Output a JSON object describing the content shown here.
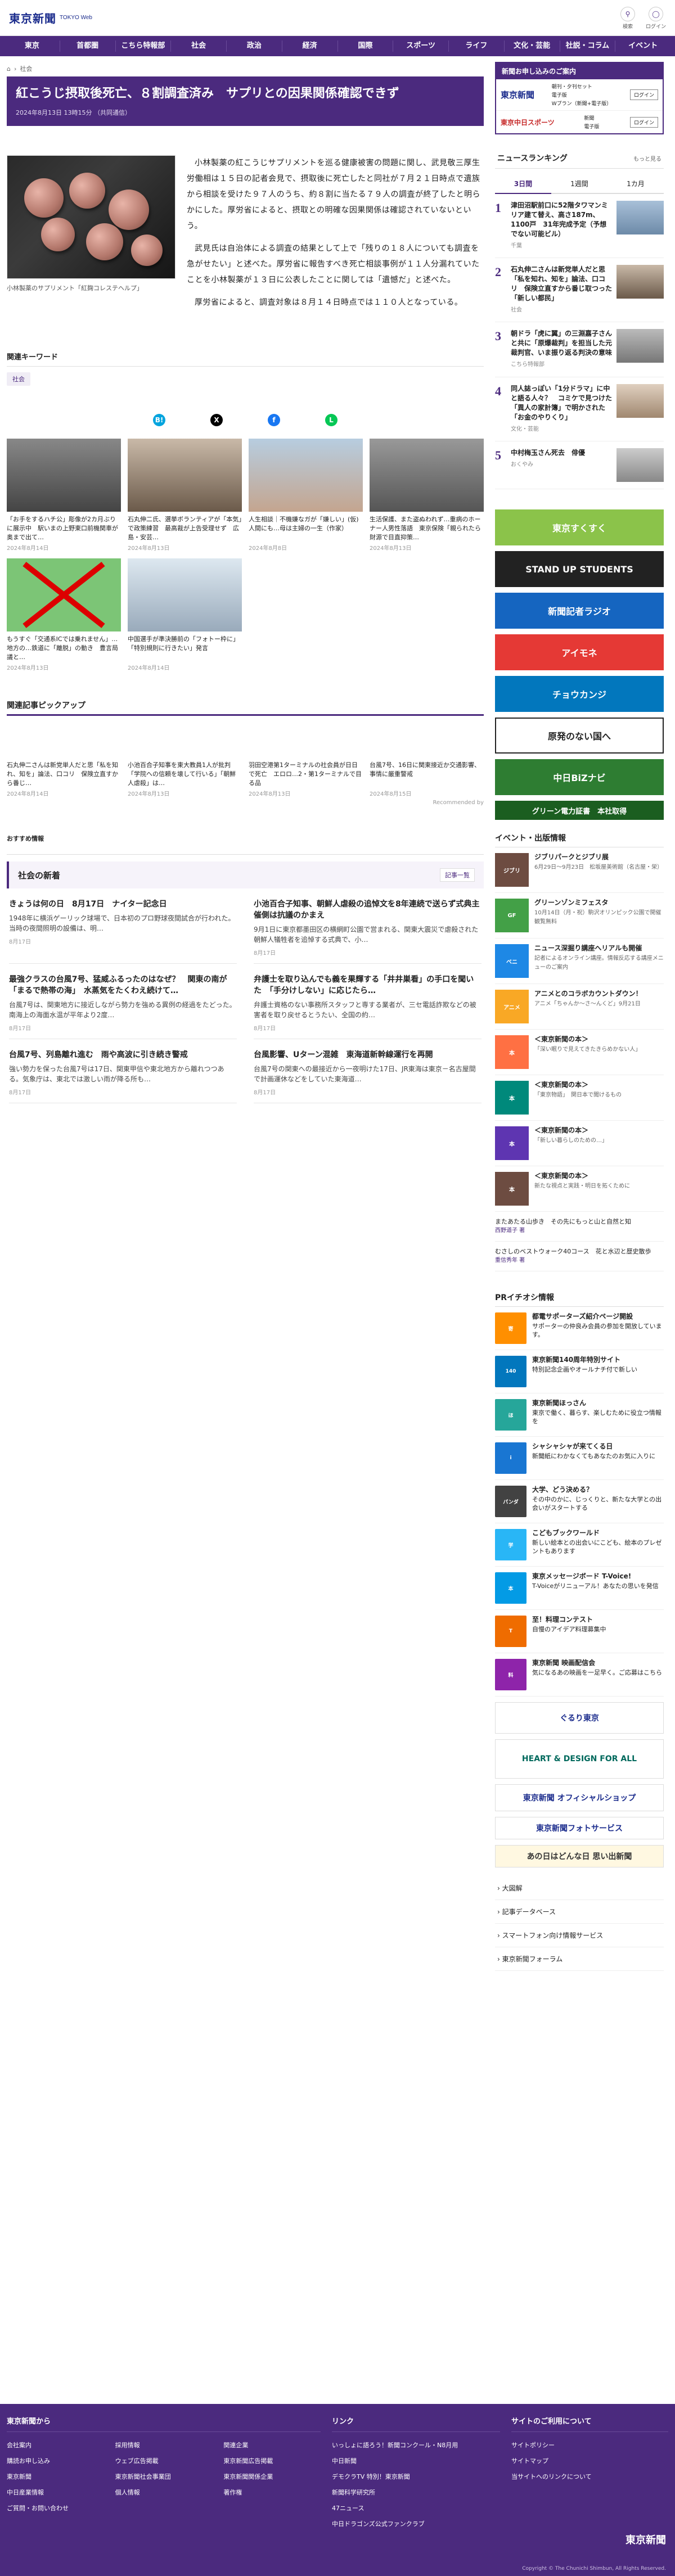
{
  "header": {
    "logo": "東京新聞",
    "logo_sub": "TOKYO Web",
    "search_label": "検索",
    "login_label": "ログイン"
  },
  "nav": [
    "東京",
    "首都圏",
    "こちら特報部",
    "社会",
    "政治",
    "経済",
    "国際",
    "スポーツ",
    "ライフ",
    "文化・芸能",
    "社説・コラム",
    "イベント"
  ],
  "breadcrumb": {
    "home": "ホーム",
    "current": "社会"
  },
  "article": {
    "title": "紅こうじ摂取後死亡、８割調査済み　サプリとの因果関係確認できず",
    "date": "2024年8月13日 13時15分",
    "source": "（共同通信）",
    "caption": "小林製薬のサプリメント「紅麹コレステヘルプ」",
    "paragraphs": [
      "小林製薬の紅こうじサプリメントを巡る健康被害の問題に関し、武見敬三厚生労働相は１５日の記者会見で、摂取後に死亡したと同社が７月２１日時点で遺族から相談を受けた９７人のうち、約８割に当たる７９人の調査が終了したと明らかにした。厚労省によると、摂取との明確な因果関係は確認されていないという。",
      "武見氏は自治体による調査の結果として上で「残りの１８人についても調査を急がせたい」と述べた。厚労省に報告すべき死亡相談事例が１１人分漏れていたことを小林製薬が１３日に公表したことに関しては「遺憾だ」と述べた。",
      "厚労省によると、調査対象は８月１４日時点では１１０人となっている。"
    ]
  },
  "keyword": {
    "title": "関連キーワード",
    "tag": "社会"
  },
  "share": {
    "facebook": "f",
    "x": "X",
    "hatena": "B!",
    "line": "L"
  },
  "related": [
    {
      "title": "「お手をするハチ公」彫像が2カ月ぶりに展示中　駅いまの上野東口前機関車が奥まで出て…",
      "date": "2024年8月14日"
    },
    {
      "title": "石丸伸二氏、選挙ボランティアが「本気」で政策練習　最高裁が上告受理せず　広島・安芸…",
      "date": "2024年8月13日"
    },
    {
      "title": "人生相談｜不機嫌なガが「嫌しい」(仮)人間にも…母は主婦の一生（作家）",
      "date": "2024年8月8日"
    },
    {
      "title": "生活保護、また盗ぬわれず…重病のホーナー人男性落語　東京保険「親られたら財源で目直抑策…",
      "date": "2024年8月13日"
    },
    {
      "title": "もうすぐ「交通系ICでは乗れません」…地方の…鉄道に「離脱」の動き　豊言局議と…",
      "date": "2024年8月13日"
    },
    {
      "title": "中国選手が準決勝前の「フォトー枠に」「特別規則に行きたい」発言",
      "date": "2024年8月14日"
    }
  ],
  "pickup": {
    "title": "関連記事ピックアップ",
    "items": [
      {
        "title": "石丸伸二さんは新党単人だと思「私を知れ、知を」論法、口コリ　保険立直すから番じ…",
        "date": "2024年8月14日"
      },
      {
        "title": "小池百合子知事を東大教員1人が批判「学院への信頼を壊して行いる」「朝鮮人虐殺」は…",
        "date": "2024年8月13日"
      },
      {
        "title": "羽田空港第1ターミナルの社会員が日日で死亡　エロロ…2・第1ターミナルで目る品",
        "date": "2024年8月13日"
      },
      {
        "title": "台風7号、16日に関東接近か交通影響、事情に厳重警戒",
        "date": "2024年8月15日"
      }
    ],
    "recommend": "Recommended by"
  },
  "osusume": "おすすめ情報",
  "shakai": {
    "title": "社会の新着",
    "more": "記事一覧",
    "items": [
      {
        "title": "きょうは何の日　8月17日　ナイター記念日",
        "body": "1948年に横浜ゲーリック球場で、日本初のプロ野球夜間試合が行われた。当時の夜間照明の設備は、明…",
        "date": "8月17日"
      },
      {
        "title": "小池百合子知事、朝鮮人虐殺の追悼文を8年連続で送らず式典主催側は抗議のかまえ",
        "body": "9月1日に東京都墨田区の横網町公園で営まれる、関東大震災で虐殺された朝鮮人犠牲者を追悼する式典で、小…",
        "date": "8月17日"
      },
      {
        "title": "最強クラスの台風7号、猛威ふるったのはなぜ？　関東の南が「まるで熱帯の海」　水蒸気をたくわえ続けて…",
        "body": "台風7号は、関東地方に接近しながら勢力を強める異例の経過をたどった。南海上の海面水温が平年より2度…",
        "date": "8月17日"
      },
      {
        "title": "弁護士を取り込んでも義を果輝する「井井巣看」の手口を聞いた　「手分けしない」に応じたら…",
        "body": "弁護士資格のない事務所スタッフと専する業者が、三セ電話詐欺などの被害者を取り戻せるとうたい、全国の約…",
        "date": "8月17日"
      },
      {
        "title": "台風7号、列島離れ進む　雨や高波に引き続き警戒",
        "body": "強い勢力を保った台風7号は17日、関東甲信や東北地方から離れつつある。気象庁は、東北では激しい雨が降る所も…",
        "date": "8月17日"
      },
      {
        "title": "台風影響、Uターン混雑　東海道新幹線運行を再開",
        "body": "台風7号の関東への最接近から一夜明けた17日、JR東海は東京－名古屋間で計画運休などをしていた東海道…",
        "date": "8月17日"
      }
    ]
  },
  "side_ad": {
    "title": "新聞お申し込みのご案内",
    "brand": "東京新聞",
    "rows": [
      {
        "name": "東京新聞",
        "lines": [
          "朝刊・夕刊セット",
          "電子版",
          "Wプラン（新聞+電子版）"
        ],
        "login": "ログイン"
      },
      {
        "name": "東京中日スポーツ",
        "lines": [
          "新聞",
          "電子版"
        ],
        "login": "ログイン"
      }
    ]
  },
  "ranking": {
    "title": "ニュースランキング",
    "more": "もっと見る",
    "tabs": [
      "3日間",
      "1週間",
      "1カ月"
    ],
    "items": [
      {
        "num": "1",
        "title": "津田沼駅前口に52階タワマンミリア建て替え、高さ187m、1100戸　31年完成予定（予想でない可能ビル）",
        "cat": "千葉"
      },
      {
        "num": "2",
        "title": "石丸伸二さんは新党単人だと思「私を知れ、知を」論法、口コリ　保険立直すから番じ取つった「新しい都民」",
        "cat": "社会"
      },
      {
        "num": "3",
        "title": "朝ドラ「虎に翼」の三淵嘉子さんと共に「原爆裁判」を担当した元裁判官、いま振り返る判決の意味",
        "cat": "こちら特報部"
      },
      {
        "num": "4",
        "title": "同人誌っぽい「1分ドラマ」に中と語る人々？　コミケで見つけた「異人の家計簿」で明かされた「お金のやりくり」",
        "cat": "文化・芸能"
      },
      {
        "num": "5",
        "title": "中村梅玉さん死去　俳優",
        "cat": "おくやみ"
      }
    ]
  },
  "banners": [
    {
      "text": "東京すくすく",
      "bg": "#8bc34a"
    },
    {
      "text": "STAND UP STUDENTS",
      "bg": "#222"
    },
    {
      "text": "新聞記者ラジオ",
      "bg": "#1565c0"
    },
    {
      "text": "アイモネ",
      "bg": "#e53935"
    },
    {
      "text": "チョウカンジ",
      "bg": "#0277bd"
    },
    {
      "text": "原発のない国へ",
      "bg": "#ffffff"
    },
    {
      "text": "中日BiZナビ",
      "bg": "#2e7d32"
    },
    {
      "text": "グリーン電力証書　本社取得",
      "bg": "#1b5e20"
    }
  ],
  "events": {
    "title": "イベント・出版情報",
    "items": [
      {
        "icon": "ジブリ",
        "title": "ジブリパークとジブリ展",
        "desc": "6月29日～9月23日　松坂屋美術館（名古屋・栄）",
        "bg": "#6d4c41"
      },
      {
        "icon": "GF",
        "title": "グリーンゾンミフェスタ",
        "desc": "10月14日（月・祝）駒沢オリンピック公園で開催　観覧無料",
        "bg": "#43a047"
      },
      {
        "icon": "ベニ",
        "title": "ニュース深掘り講座へリアルも開催",
        "desc": "記者によるオンライン講座。情報反応する講座メニューのご案内",
        "bg": "#1e88e5"
      },
      {
        "icon": "アニメ",
        "title": "アニメとのコラボカウントダウン！",
        "desc": "アニメ「ちゃんか～さ～んくど」9月21日",
        "bg": "#f9a825"
      },
      {
        "icon": "本",
        "title": "＜東京新聞の本＞",
        "desc": "「深い眠りで見えてきたきらめかない人」",
        "bg": "#ff7043"
      },
      {
        "icon": "本",
        "title": "＜東京新聞の本＞",
        "desc": "「東京物語」　関日本で聞けるもの",
        "bg": "#00897b"
      },
      {
        "icon": "本",
        "title": "＜東京新聞の本＞",
        "desc": "「新しい暮らしのための…」",
        "bg": "#5e35b1"
      },
      {
        "icon": "本",
        "title": "＜東京新聞の本＞",
        "desc": "新たな視点と実践・明日を拓くために",
        "bg": "#6d4c41"
      }
    ],
    "links": [
      {
        "title": "またあたる山歩き　その先にもっと山と自然と知",
        "sub": "西野道子 著"
      },
      {
        "title": "むさしのベストウォーク40コース　花と水辺と歴史散歩",
        "sub": "重信秀年 著"
      }
    ]
  },
  "pr": {
    "title": "PRイチオシ情報",
    "items": [
      {
        "icon": "寄",
        "title": "都電サポーターズ紹介ページ開設",
        "desc": "サポーターの仲良み会員の参加を開放しています。",
        "bg": "#ff8f00"
      },
      {
        "icon": "140",
        "title": "東京新聞140周年特別サイト",
        "desc": "特別記念企画やオールナチ付で新しい",
        "bg": "#0277bd"
      },
      {
        "icon": "ほ",
        "title": "東京新聞ほっさん",
        "desc": "東京で働く、暮らす、楽しむために役立つ情報を",
        "bg": "#26a69a"
      },
      {
        "icon": "i",
        "title": "シャシャシャが来てくる日",
        "desc": "新聞紙にわかなくてもあなたのお気に入りに",
        "bg": "#1976d2"
      },
      {
        "icon": "パンダ",
        "title": "大学、どう決める？",
        "desc": "その中のかに、じっくりと、新たな大学との出会いがスタートする",
        "bg": "#424242"
      },
      {
        "icon": "学",
        "title": "こどもブックワールド",
        "desc": "新しい絵本との出会いにこども、絵本のプレゼントもあります",
        "bg": "#29b6f6"
      },
      {
        "icon": "本",
        "title": "東京メッセージボード T-Voice!",
        "desc": "T-Voiceがリニューアル！あなたの思いを発信",
        "bg": "#039be5"
      },
      {
        "icon": "T",
        "title": "至！料理コンテスト",
        "desc": "自慢のアイデア料理募集中",
        "bg": "#ef6c00"
      },
      {
        "icon": "料",
        "title": "東京新聞 映画配信会",
        "desc": "気になるあの映画を一足早く。ご応募はこちら",
        "bg": "#8e24aa"
      }
    ]
  },
  "bottom_banners": [
    {
      "text": "ぐるり東京",
      "bg": "#fff"
    },
    {
      "text": "HEART & DESIGN FOR ALL",
      "bg": "#fff"
    },
    {
      "text": "東京新聞 オフィシャルショップ",
      "bg": "#fff"
    },
    {
      "text": "東京新聞フォトサービス",
      "bg": "#fff"
    },
    {
      "text": "あの日はどんな日 思い出新聞",
      "bg": "#fff"
    }
  ],
  "side_links": [
    "大図解",
    "記事データベース",
    "スマートフォン向け情報サービス",
    "東京新聞フォーラム"
  ],
  "footer": {
    "col1": {
      "title": "東京新聞から",
      "links": [
        "会社案内",
        "採用情報",
        "関連企業",
        "購読お申し込み",
        "ウェブ広告掲載",
        "東京新聞広告掲載",
        "東京新聞",
        "東京新聞社会事業団",
        "東京新聞関係企業",
        "中日産業情報",
        "個人情報",
        "著作権",
        "ご質問・お問い合わせ"
      ]
    },
    "col2": {
      "title": "リンク",
      "links": [
        "いっしょに語ろう！新聞コンクール・N8月用",
        "中日新聞",
        "デモクラTV 特別！東京新聞",
        "新聞科学研究所",
        "47ニュース",
        "中日ドラゴンズ公式ファンクラブ"
      ]
    },
    "col3": {
      "title": "サイトのご利用について",
      "links": [
        "サイトポリシー",
        "サイトマップ",
        "当サイトへのリンクについて"
      ]
    },
    "logo": "東京新聞",
    "copyright": "Copyright © The Chunichi Shimbun, All Rights Reserved."
  }
}
